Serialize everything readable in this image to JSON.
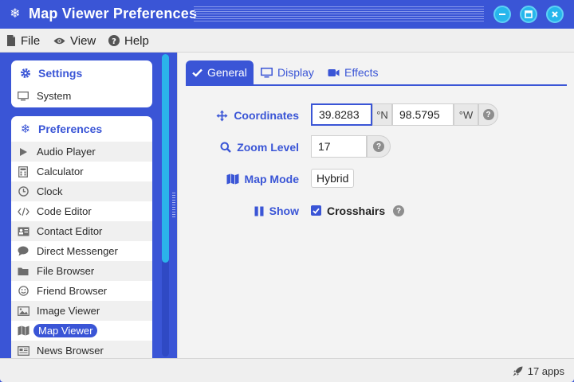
{
  "window": {
    "title": "Map Viewer Preferences",
    "accent": "#3a55d6",
    "window_button_color": "#26b6ec"
  },
  "menubar": {
    "items": [
      {
        "label": "File",
        "icon": "file-icon"
      },
      {
        "label": "View",
        "icon": "eye-icon"
      },
      {
        "label": "Help",
        "icon": "question-circle-icon"
      }
    ]
  },
  "sidebar": {
    "settings": {
      "title": "Settings",
      "items": [
        {
          "label": "System",
          "icon": "monitor-icon"
        }
      ]
    },
    "preferences": {
      "title": "Preferences",
      "items": [
        {
          "label": "Audio Player",
          "icon": "play-icon"
        },
        {
          "label": "Calculator",
          "icon": "calculator-icon"
        },
        {
          "label": "Clock",
          "icon": "clock-icon"
        },
        {
          "label": "Code Editor",
          "icon": "code-icon"
        },
        {
          "label": "Contact Editor",
          "icon": "contact-card-icon"
        },
        {
          "label": "Direct Messenger",
          "icon": "chat-bubble-icon"
        },
        {
          "label": "File Browser",
          "icon": "folder-icon"
        },
        {
          "label": "Friend Browser",
          "icon": "smiley-icon"
        },
        {
          "label": "Image Viewer",
          "icon": "image-icon"
        },
        {
          "label": "Map Viewer",
          "icon": "map-icon",
          "selected": true
        },
        {
          "label": "News Browser",
          "icon": "newspaper-icon"
        }
      ]
    }
  },
  "tabs": [
    {
      "label": "General",
      "icon": "check-icon",
      "active": true
    },
    {
      "label": "Display",
      "icon": "monitor-icon"
    },
    {
      "label": "Effects",
      "icon": "video-camera-icon"
    }
  ],
  "form": {
    "coordinates": {
      "label": "Coordinates",
      "latitude": "39.8283",
      "lat_unit": "°N",
      "longitude": "98.5795",
      "lon_unit": "°W"
    },
    "zoom": {
      "label": "Zoom Level",
      "value": "17"
    },
    "map_mode": {
      "label": "Map Mode",
      "value": "Hybrid"
    },
    "show": {
      "label": "Show",
      "crosshairs_label": "Crosshairs",
      "crosshairs_checked": true
    }
  },
  "statusbar": {
    "text": "17 apps"
  }
}
